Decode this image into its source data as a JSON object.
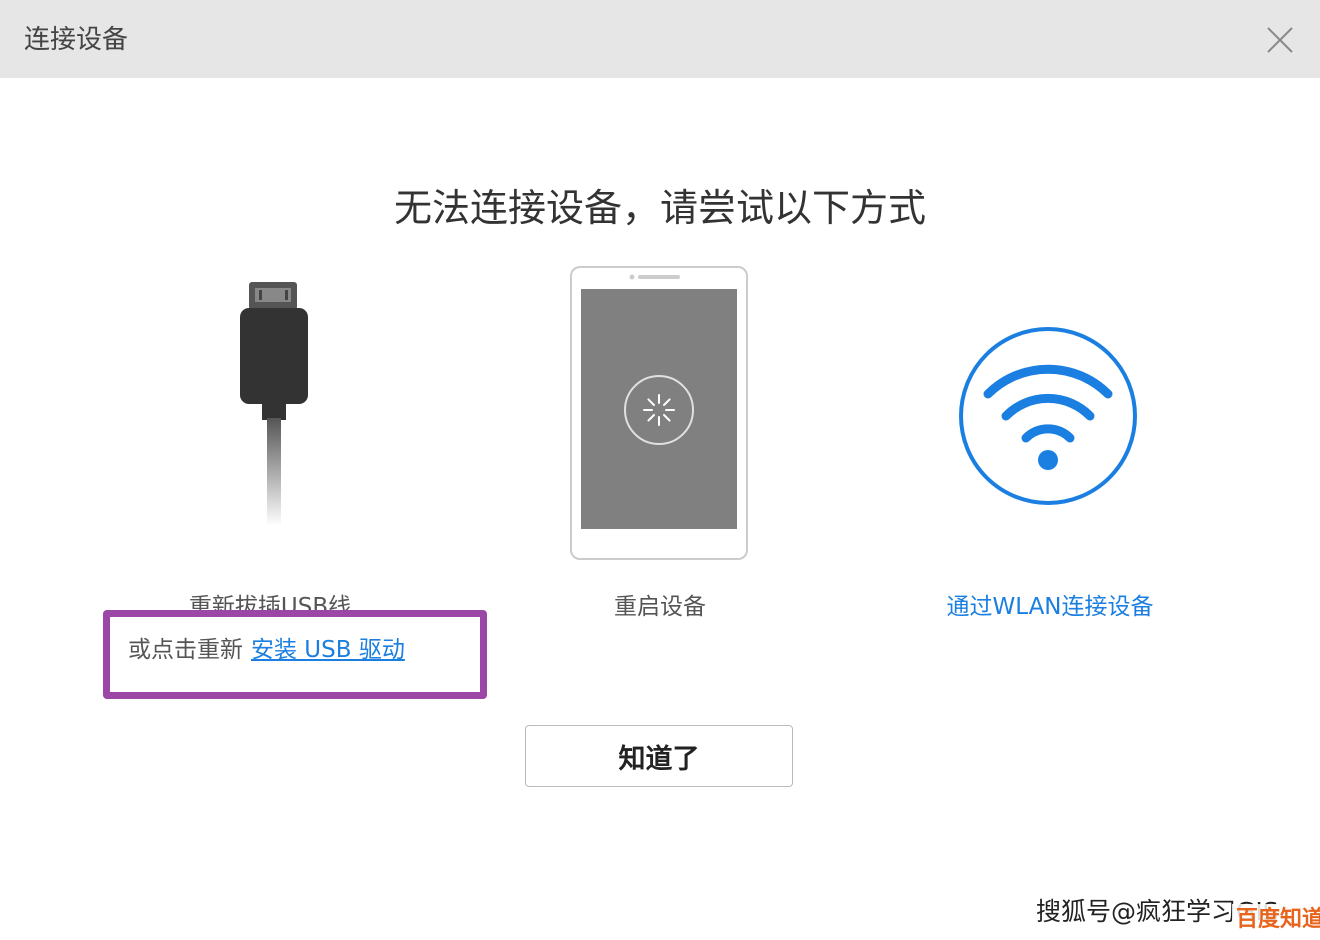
{
  "window": {
    "title": "连接设备",
    "close_icon": "close-icon"
  },
  "main": {
    "headline": "无法连接设备，请尝试以下方式",
    "options": [
      {
        "icon": "usb-cable-icon",
        "label": "重新拔插USB线"
      },
      {
        "icon": "phone-restart-icon",
        "label": "重启设备"
      },
      {
        "icon": "wifi-icon",
        "label": "通过WLAN连接设备"
      }
    ],
    "driver_prompt": {
      "prefix": "或点击重新",
      "link": "安装 USB 驱动"
    },
    "confirm_button": "知道了"
  },
  "watermark": {
    "text": "搜狐号@疯狂学习GIS",
    "badge": "百度知道"
  },
  "colors": {
    "accent": "#1a7fe0",
    "highlight_border": "#9b47a6",
    "titlebar_bg": "#e6e6e6"
  }
}
